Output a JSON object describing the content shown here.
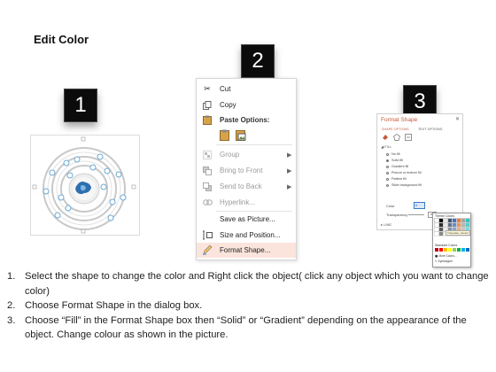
{
  "title": "Edit Color",
  "badges": [
    "1",
    "2",
    "3"
  ],
  "context_menu": {
    "items": [
      {
        "label": "Cut",
        "icon": "scissors-icon",
        "state": "normal"
      },
      {
        "label": "Copy",
        "icon": "copy-icon",
        "state": "normal"
      },
      {
        "label": "Paste Options:",
        "icon": "clipboard-icon",
        "state": "header"
      },
      {
        "label": "Group",
        "icon": "group-icon",
        "state": "disabled",
        "submenu": true
      },
      {
        "label": "Bring to Front",
        "icon": "bring-front-icon",
        "state": "disabled",
        "submenu": true
      },
      {
        "label": "Send to Back",
        "icon": "send-back-icon",
        "state": "disabled",
        "submenu": true
      },
      {
        "label": "Hyperlink...",
        "icon": "hyperlink-icon",
        "state": "disabled"
      },
      {
        "label": "Save as Picture...",
        "icon": "",
        "state": "normal"
      },
      {
        "label": "Size and Position...",
        "icon": "size-position-icon",
        "state": "normal"
      },
      {
        "label": "Format Shape...",
        "icon": "format-shape-icon",
        "state": "highlighted"
      }
    ]
  },
  "format_pane": {
    "title": "Format Shape",
    "close": "✕",
    "tabs": [
      "SHAPE OPTIONS",
      "TEXT OPTIONS"
    ],
    "section_fill": "FILL",
    "fill_options": [
      "No fill",
      "Solid fill",
      "Gradient fill",
      "Picture or texture fill",
      "Pattern fill",
      "Slide background fill"
    ],
    "selected_fill": "Solid fill",
    "color_label": "Color",
    "transparency_label": "Transparency",
    "transparency_value": "0%",
    "section_line": "LINE",
    "palette": {
      "theme_label": "Theme Colors",
      "standard_label": "Standard Colors",
      "more_label": "More Colors...",
      "eyedropper_label": "Eyedropper",
      "tooltip": "Turquoise, Accent"
    }
  },
  "steps": [
    {
      "num": "1.",
      "text": "Select the shape to change the color and Right click the object( click any object which you want to change color)"
    },
    {
      "num": "2.",
      "text": "Choose Format Shape in the dialog box."
    },
    {
      "num": "3.",
      "text": "Choose “Fill” in the Format Shape box then “Solid” or “Gradient” depending on the appearance of the object. Change colour as shown in the picture."
    }
  ],
  "colors": {
    "highlight": "#fbe4dc",
    "accent": "#c55a3a",
    "diagram_blue": "#6aa9d6",
    "badge_bg": "#0b0b0b"
  }
}
